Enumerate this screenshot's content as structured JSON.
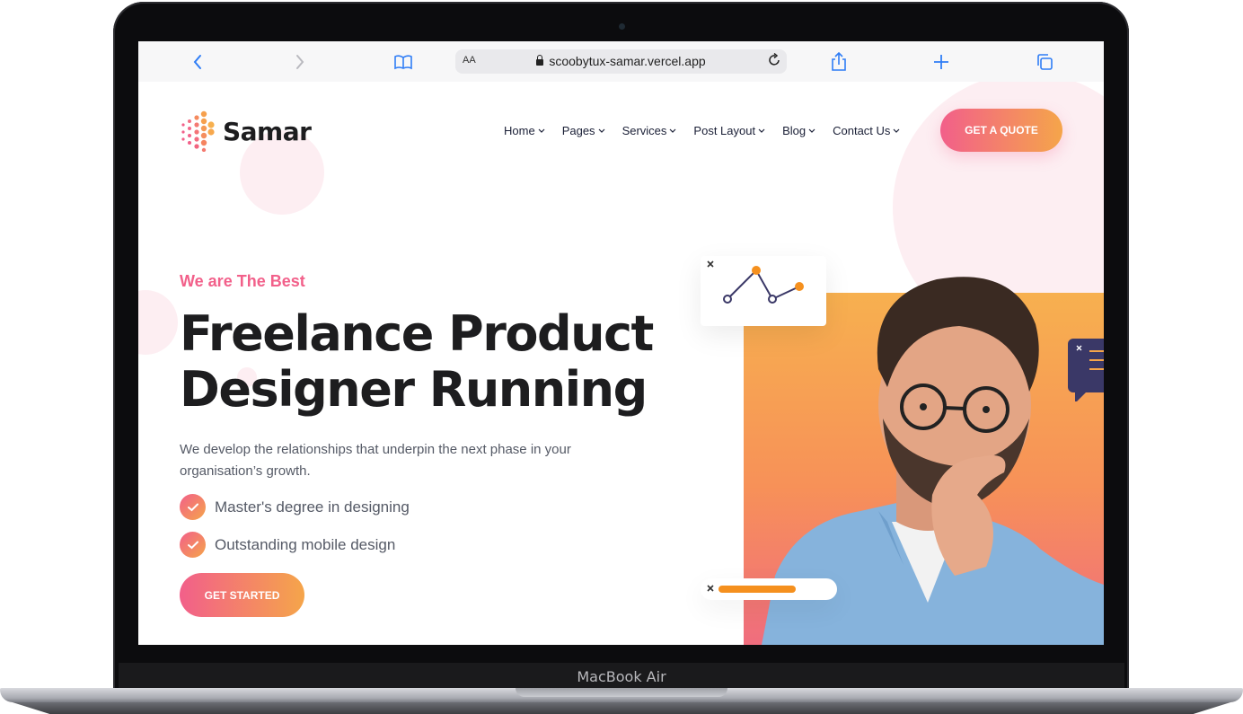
{
  "device": {
    "label": "MacBook Air"
  },
  "browser": {
    "text_size_label": "AA",
    "url": "scoobytux-samar.vercel.app"
  },
  "site": {
    "logo_text": "Samar",
    "nav": [
      {
        "label": "Home"
      },
      {
        "label": "Pages"
      },
      {
        "label": "Services"
      },
      {
        "label": "Post Layout"
      },
      {
        "label": "Blog"
      },
      {
        "label": "Contact Us"
      }
    ],
    "cta_label": "GET A QUOTE"
  },
  "hero": {
    "eyebrow": "We are The Best",
    "headline_line1": "Freelance Product",
    "headline_line2": "Designer Running",
    "description": "We develop the relationships that underpin the next phase in your organisation’s growth.",
    "features": [
      {
        "text": "Master's degree in designing"
      },
      {
        "text": "Outstanding mobile design"
      }
    ],
    "button_label": "GET STARTED"
  },
  "colors": {
    "accent_pink": "#f25f8a",
    "accent_orange": "#f5a54a",
    "heading": "#1d1d1f",
    "nav_text": "#1a1f36"
  }
}
